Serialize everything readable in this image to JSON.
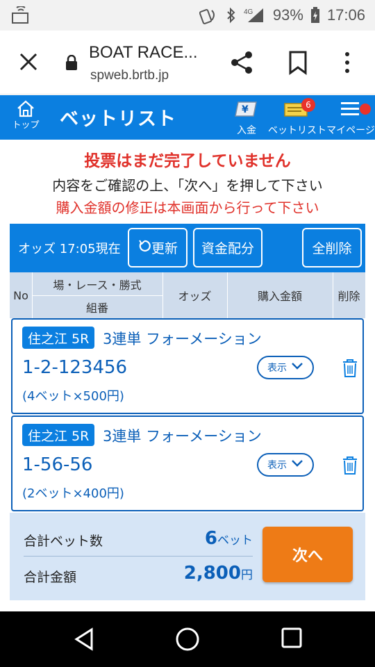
{
  "status_bar": {
    "battery_percent": "93%",
    "time": "17:06",
    "network": "4G",
    "icons": [
      "cast-icon",
      "nfc-icon",
      "bluetooth-icon",
      "signal-icon",
      "battery-charging-icon"
    ]
  },
  "browser": {
    "page_title": "BOAT RACE...",
    "url": "spweb.brtb.jp",
    "icons": [
      "close-icon",
      "lock-icon",
      "share-icon",
      "bookmark-icon",
      "more-icon"
    ]
  },
  "header": {
    "home_label": "トップ",
    "title": "ベットリスト",
    "deposit_label": "入金",
    "betlist_label": "ベットリスト",
    "betlist_badge": "6",
    "mypage_label": "マイページ"
  },
  "notices": {
    "line1": "投票はまだ完了していません",
    "line2": "内容をご確認の上、「次へ」を押して下さい",
    "line3": "購入金額の修正は本画面から行って下さい"
  },
  "odds_bar": {
    "time_text": "オッズ 17:05現在",
    "refresh_label": "更新",
    "allocate_label": "資金配分",
    "clear_all_label": "全削除"
  },
  "table_header": {
    "no": "No",
    "venue_race": "場・レース・勝式",
    "combination": "組番",
    "odds": "オッズ",
    "amount": "購入金額",
    "delete": "削除"
  },
  "bets": [
    {
      "venue": "住之江 5R",
      "type": "3連単 フォーメーション",
      "combination": "1-2-123456",
      "detail": "(4ベット×500円)",
      "show_label": "表示"
    },
    {
      "venue": "住之江 5R",
      "type": "3連単 フォーメーション",
      "combination": "1-56-56",
      "detail": "(2ベット×400円)",
      "show_label": "表示"
    }
  ],
  "totals": {
    "bet_count_label": "合計ベット数",
    "bet_count": "6",
    "bet_unit": "ベット",
    "amount_label": "合計金額",
    "amount": "2,800",
    "amount_unit": "円",
    "next_label": "次へ"
  },
  "colors": {
    "primary_blue": "#0b7fe0",
    "dark_blue": "#0b5fb8",
    "alert_red": "#e0312a",
    "next_orange": "#ee7b16",
    "totals_bg": "#d6e5f6"
  }
}
